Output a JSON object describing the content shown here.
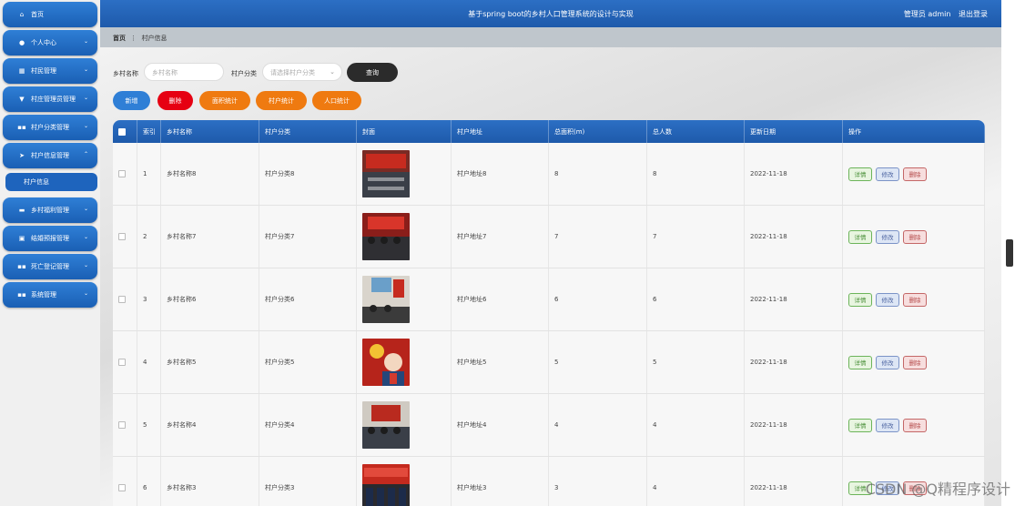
{
  "header": {
    "title": "基于spring boot的乡村人口管理系统的设计与实现",
    "admin_label": "管理员 admin",
    "logout_label": "退出登录"
  },
  "sidebar": {
    "items": [
      {
        "label": "首页",
        "icon": "home-icon",
        "glyph": "⌂"
      },
      {
        "label": "个人中心",
        "icon": "user-icon",
        "glyph": "●"
      },
      {
        "label": "村民管理",
        "icon": "building-icon",
        "glyph": "▦"
      },
      {
        "label": "村庄管理员管理",
        "icon": "trophy-icon",
        "glyph": "▼"
      },
      {
        "label": "村户分类管理",
        "icon": "grid-icon",
        "glyph": "▪▪"
      },
      {
        "label": "村户信息管理",
        "icon": "send-icon",
        "glyph": "➤"
      },
      {
        "label": "乡村福利管理",
        "icon": "monitor-icon",
        "glyph": "▬"
      },
      {
        "label": "结婚预报管理",
        "icon": "calendar-icon",
        "glyph": "▣"
      },
      {
        "label": "死亡登记管理",
        "icon": "grid-icon",
        "glyph": "▪▪"
      },
      {
        "label": "系统管理",
        "icon": "grid-icon",
        "glyph": "▪▪"
      }
    ],
    "sub_item": "村户信息"
  },
  "breadcrumb": {
    "home": "首页",
    "separator": "⋮",
    "current": "村户信息"
  },
  "search": {
    "name_label": "乡村名称",
    "name_placeholder": "乡村名称",
    "category_label": "村户分类",
    "category_placeholder": "请选择村户分类",
    "button": "查询"
  },
  "actions": [
    {
      "label": "新增",
      "color": "#2f7fd6"
    },
    {
      "label": "删除",
      "color": "#e60012"
    },
    {
      "label": "面积统计",
      "color": "#ef7a10"
    },
    {
      "label": "村户统计",
      "color": "#ef7a10"
    },
    {
      "label": "人口统计",
      "color": "#ef7a10"
    }
  ],
  "table": {
    "headers": [
      "索引",
      "乡村名称",
      "村户分类",
      "封面",
      "村户地址",
      "总面积(m)",
      "总人数",
      "更新日期",
      "操作"
    ],
    "rows": [
      {
        "index": "1",
        "name": "乡村名称8",
        "category": "村户分类8",
        "address": "村户地址8",
        "area": "8",
        "people": "8",
        "date": "2022-11-18"
      },
      {
        "index": "2",
        "name": "乡村名称7",
        "category": "村户分类7",
        "address": "村户地址7",
        "area": "7",
        "people": "7",
        "date": "2022-11-18"
      },
      {
        "index": "3",
        "name": "乡村名称6",
        "category": "村户分类6",
        "address": "村户地址6",
        "area": "6",
        "people": "6",
        "date": "2022-11-18"
      },
      {
        "index": "4",
        "name": "乡村名称5",
        "category": "村户分类5",
        "address": "村户地址5",
        "area": "5",
        "people": "5",
        "date": "2022-11-18"
      },
      {
        "index": "5",
        "name": "乡村名称4",
        "category": "村户分类4",
        "address": "村户地址4",
        "area": "4",
        "people": "4",
        "date": "2022-11-18"
      },
      {
        "index": "6",
        "name": "乡村名称3",
        "category": "村户分类3",
        "address": "村户地址3",
        "area": "3",
        "people": "4",
        "date": "2022-11-18"
      }
    ],
    "op_labels": {
      "detail": "详情",
      "edit": "修改",
      "delete": "删除"
    }
  },
  "watermark": "CSDN @Q精程序设计"
}
